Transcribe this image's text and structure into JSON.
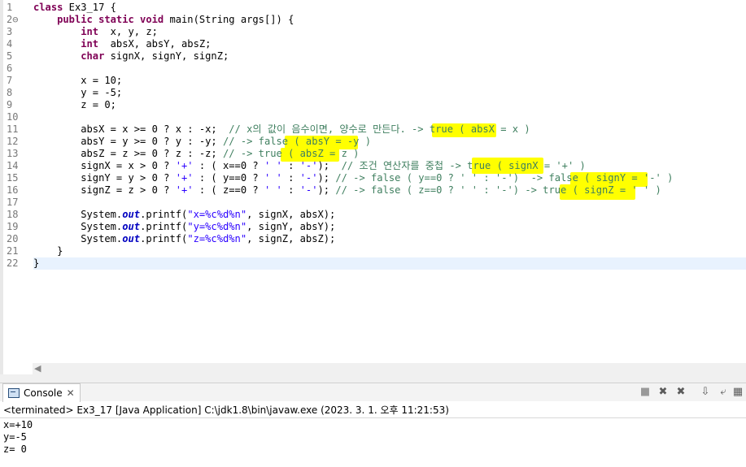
{
  "editor": {
    "lines": [
      {
        "num": "1",
        "segs": [
          {
            "c": "kw",
            "t": "class"
          },
          {
            "t": " Ex3_17 {"
          }
        ]
      },
      {
        "num": "2⊖",
        "segs": [
          {
            "t": "    "
          },
          {
            "c": "kw",
            "t": "public static void"
          },
          {
            "t": " main(String args[]) {"
          }
        ]
      },
      {
        "num": "3",
        "segs": [
          {
            "t": "        "
          },
          {
            "c": "kw",
            "t": "int"
          },
          {
            "t": "  x, y, z;"
          }
        ]
      },
      {
        "num": "4",
        "segs": [
          {
            "t": "        "
          },
          {
            "c": "kw",
            "t": "int"
          },
          {
            "t": "  absX, absY, absZ;"
          }
        ]
      },
      {
        "num": "5",
        "segs": [
          {
            "t": "        "
          },
          {
            "c": "kw",
            "t": "char"
          },
          {
            "t": " signX, signY, signZ;"
          }
        ]
      },
      {
        "num": "6",
        "segs": []
      },
      {
        "num": "7",
        "segs": [
          {
            "t": "        x = 10;"
          }
        ]
      },
      {
        "num": "8",
        "segs": [
          {
            "t": "        y = -5;"
          }
        ]
      },
      {
        "num": "9",
        "segs": [
          {
            "t": "        z = 0;"
          }
        ]
      },
      {
        "num": "10",
        "segs": []
      },
      {
        "num": "11",
        "segs": [
          {
            "t": "        absX = x >= 0 ? x : -x;  "
          },
          {
            "c": "cmt",
            "t": "// x의 값이 음수이면, 양수로 만든다. -> true ( absX = x )"
          }
        ]
      },
      {
        "num": "12",
        "segs": [
          {
            "t": "        absY = y >= 0 ? y : -y; "
          },
          {
            "c": "cmt",
            "t": "// -> false ( absY = -y )"
          }
        ]
      },
      {
        "num": "13",
        "segs": [
          {
            "t": "        absZ = z >= 0 ? z : -z; "
          },
          {
            "c": "cmt",
            "t": "// -> true ( absZ = z )"
          }
        ]
      },
      {
        "num": "14",
        "segs": [
          {
            "t": "        signX = x > 0 ? "
          },
          {
            "c": "str",
            "t": "'+'"
          },
          {
            "t": " : ( x==0 ? "
          },
          {
            "c": "str",
            "t": "' '"
          },
          {
            "t": " : "
          },
          {
            "c": "str",
            "t": "'-'"
          },
          {
            "t": ");  "
          },
          {
            "c": "cmt",
            "t": "// 조건 연산자를 중첩 -> true ( signX = '+' )"
          }
        ]
      },
      {
        "num": "15",
        "segs": [
          {
            "t": "        signY = y > 0 ? "
          },
          {
            "c": "str",
            "t": "'+'"
          },
          {
            "t": " : ( y==0 ? "
          },
          {
            "c": "str",
            "t": "' '"
          },
          {
            "t": " : "
          },
          {
            "c": "str",
            "t": "'-'"
          },
          {
            "t": "); "
          },
          {
            "c": "cmt",
            "t": "// -> false ( y==0 ? ' ' : '-')  -> false ( signY = '-' )"
          }
        ]
      },
      {
        "num": "16",
        "segs": [
          {
            "t": "        signZ = z > 0 ? "
          },
          {
            "c": "str",
            "t": "'+'"
          },
          {
            "t": " : ( z==0 ? "
          },
          {
            "c": "str",
            "t": "' '"
          },
          {
            "t": " : "
          },
          {
            "c": "str",
            "t": "'-'"
          },
          {
            "t": "); "
          },
          {
            "c": "cmt",
            "t": "// -> false ( z==0 ? ' ' : '-') -> true ( signZ = ' ' )"
          }
        ]
      },
      {
        "num": "17",
        "segs": []
      },
      {
        "num": "18",
        "segs": [
          {
            "t": "        System."
          },
          {
            "c": "fld",
            "t": "out"
          },
          {
            "t": ".printf("
          },
          {
            "c": "str",
            "t": "\"x=%c%d%n\""
          },
          {
            "t": ", signX, absX);"
          }
        ]
      },
      {
        "num": "19",
        "segs": [
          {
            "t": "        System."
          },
          {
            "c": "fld",
            "t": "out"
          },
          {
            "t": ".printf("
          },
          {
            "c": "str",
            "t": "\"y=%c%d%n\""
          },
          {
            "t": ", signY, absY);"
          }
        ]
      },
      {
        "num": "20",
        "segs": [
          {
            "t": "        System."
          },
          {
            "c": "fld",
            "t": "out"
          },
          {
            "t": ".printf("
          },
          {
            "c": "str",
            "t": "\"z=%c%d%n\""
          },
          {
            "t": ", signZ, absZ);"
          }
        ]
      },
      {
        "num": "21",
        "segs": [
          {
            "t": "    }"
          }
        ]
      },
      {
        "num": "22",
        "segs": [
          {
            "t": "}"
          }
        ]
      }
    ]
  },
  "console": {
    "tab_label": "Console",
    "close_glyph": "✕",
    "status": "<terminated> Ex3_17 [Java Application] C:\\jdk1.8\\bin\\javaw.exe (2023. 3. 1. 오후 11:21:53)",
    "output": [
      "x=+10",
      "y=-5",
      "z= 0"
    ],
    "toolbar": {
      "terminate": "■",
      "remove_launch": "✖",
      "remove_all": "✖",
      "scroll_lock": "⇩",
      "word_wrap": "⤶",
      "pin": "▦",
      "display": "▣"
    }
  },
  "colors": {
    "highlight": "#ffff00",
    "keyword": "#7f0055",
    "string": "#2a00ff",
    "comment": "#3f7f5f",
    "current_line": "#e8f2fe"
  }
}
